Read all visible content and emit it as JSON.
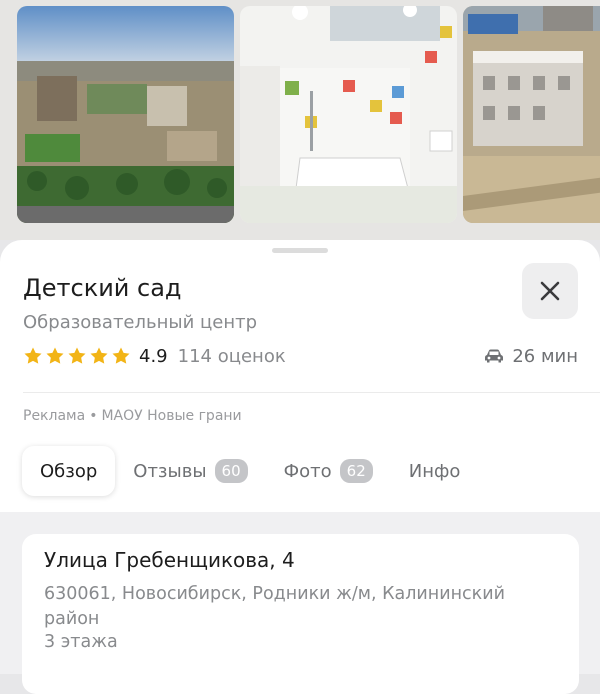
{
  "photos": [
    {
      "name": "aerial-view-photo"
    },
    {
      "name": "shower-room-photo"
    },
    {
      "name": "building-construction-photo"
    }
  ],
  "place": {
    "title": "Детский сад",
    "category": "Образовательный центр",
    "rating_value": "4.9",
    "rating_stars": 5,
    "rating_count": "114 оценок",
    "route_time": "26 мин",
    "route_icon": "car-icon"
  },
  "ad": {
    "label": "Реклама",
    "separator": "•",
    "sponsor": "МАОУ Новые грани"
  },
  "tabs": [
    {
      "label": "Обзор",
      "badge": ""
    },
    {
      "label": "Отзывы",
      "badge": "60"
    },
    {
      "label": "Фото",
      "badge": "62"
    },
    {
      "label": "Инфо",
      "badge": ""
    }
  ],
  "address": {
    "street": "Улица Гребенщикова, 4",
    "details": "630061, Новосибирск, Родники ж/м, Калининский район",
    "floors": "3 этажа"
  },
  "colors": {
    "star": "#f2b416",
    "badge": "#c4c5c8"
  }
}
